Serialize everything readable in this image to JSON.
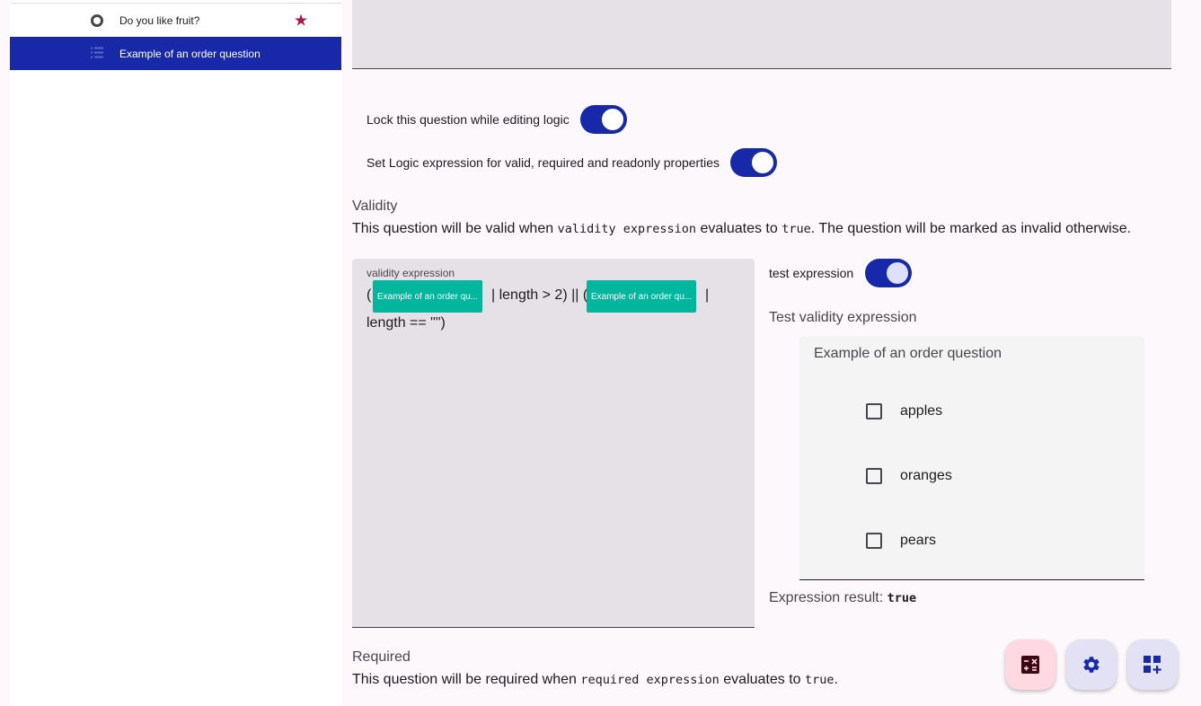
{
  "sidebar": {
    "items": [
      {
        "label": "Do you like fruit?",
        "icon": "radio-icon",
        "badge_icon": "star-icon"
      },
      {
        "label": "Example of an order question",
        "icon": "list-icon",
        "selected": true
      }
    ]
  },
  "logic": {
    "lock_label": "Lock this question while editing logic",
    "lock_on": true,
    "set_logic_label": "Set Logic expression for valid, required and readonly properties",
    "set_logic_on": true
  },
  "validity": {
    "title": "Validity",
    "desc_prefix": "This question will be valid when",
    "desc_code": "validity expression",
    "desc_mid": "evaluates to",
    "desc_code2": "true",
    "desc_suffix": ". The question will be marked as invalid otherwise.",
    "expression_label": "validity expression",
    "expr_open1": "(",
    "chip1": "Example of an order qu...",
    "expr_part1": "| length > 2) || (",
    "chip2": "Example of an order qu...",
    "expr_part2": "|",
    "expr_line2": "length == \"\")",
    "test_label": "test expression",
    "test_on": true,
    "test_title": "Test validity expression",
    "test_question": "Example of an order question",
    "options": [
      "apples",
      "oranges",
      "pears"
    ],
    "result_label": "Expression result:",
    "result_value": "true"
  },
  "required": {
    "title": "Required",
    "desc_prefix": "This question will be required when",
    "desc_code": "required expression",
    "desc_mid": "evaluates to",
    "desc_code2": "true",
    "desc_suffix": "."
  },
  "fabs": [
    {
      "icon": "calculator-icon",
      "color": "#ffd9e2"
    },
    {
      "icon": "gear-icon",
      "color": "#e3e2f5"
    },
    {
      "icon": "add-widget-icon",
      "color": "#e3e2f5"
    }
  ],
  "colors": {
    "accent": "#1729a8",
    "chip": "#00b69c",
    "star": "#b0104b"
  }
}
